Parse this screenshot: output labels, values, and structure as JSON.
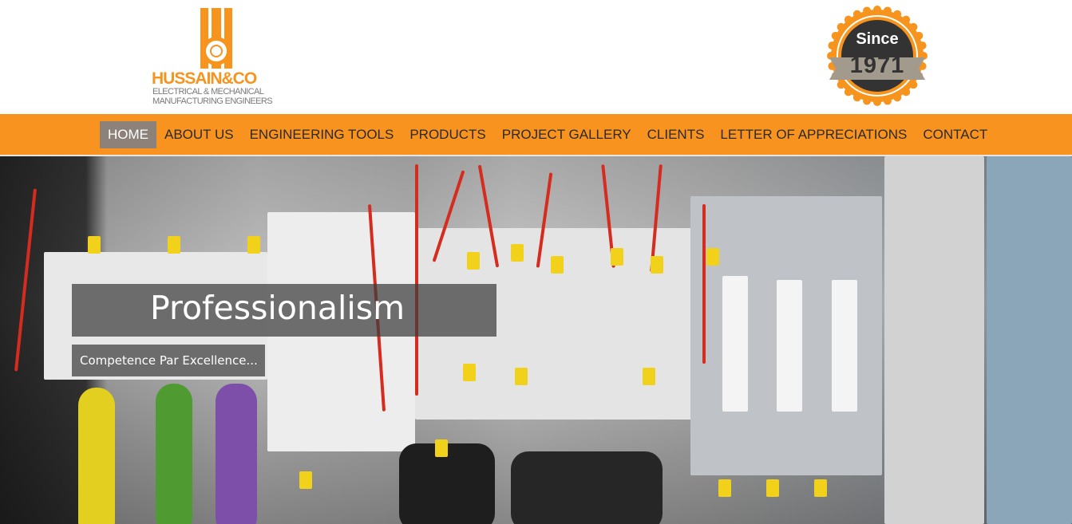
{
  "brand": {
    "name": "HUSSAIN&CO",
    "tagline_1": "ELECTRICAL & MECHANICAL",
    "tagline_2": "MANUFACTURING ENGINEERS",
    "color": "#f7941e"
  },
  "badge": {
    "since": "Since",
    "year": "1971"
  },
  "nav": {
    "items": [
      {
        "label": "HOME",
        "active": true
      },
      {
        "label": "ABOUT US"
      },
      {
        "label": "ENGINEERING TOOLS"
      },
      {
        "label": "PRODUCTS"
      },
      {
        "label": "PROJECT GALLERY"
      },
      {
        "label": "CLIENTS"
      },
      {
        "label": "LETTER OF APPRECIATIONS"
      },
      {
        "label": "CONTACT"
      }
    ],
    "background": "#f7931e",
    "active_background": "#8c8279"
  },
  "hero": {
    "title": "Professionalism",
    "subtitle": "Competence Par Excellence..."
  }
}
